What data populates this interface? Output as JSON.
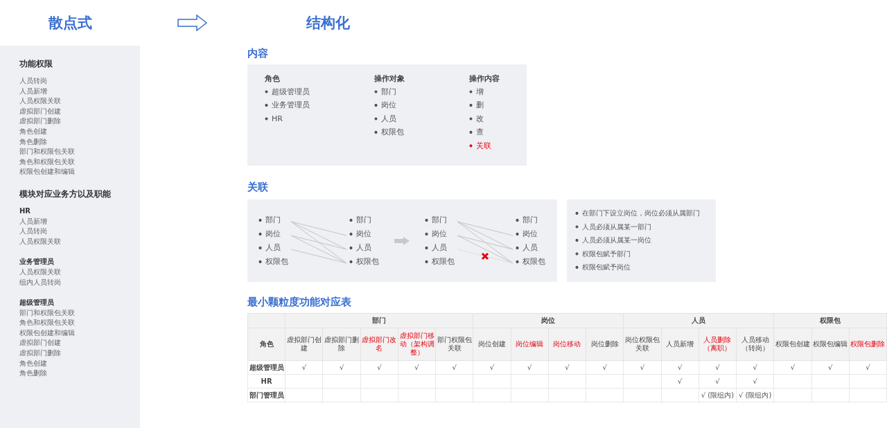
{
  "header": {
    "left_title": "散点式",
    "right_title": "结构化"
  },
  "sidebar": {
    "sections": [
      {
        "title": "功能权限",
        "groups": [
          {
            "items": [
              "人员转岗",
              "人员新增",
              "人员权限关联",
              "虚拟部门创建",
              "虚拟部门删除",
              "角色创建",
              "角色删除",
              "部门和权限包关联",
              "角色和权限包关联",
              "权限包创建和编辑"
            ]
          }
        ]
      },
      {
        "title": "模块对应业务方以及职能",
        "groups": [
          {
            "name": "HR",
            "items": [
              "人员新增",
              "人员转岗",
              "人员权限关联"
            ]
          },
          {
            "name": "业务管理员",
            "items": [
              "人员权限关联",
              "组内人员转岗"
            ]
          },
          {
            "name": "超级管理员",
            "items": [
              "部门和权限包关联",
              "角色和权限包关联",
              "权限包创建和编辑",
              "虚拟部门创建",
              "虚拟部门删除",
              "角色创建",
              "角色删除"
            ]
          }
        ]
      }
    ]
  },
  "content": {
    "title": "内容",
    "columns": [
      {
        "heading": "角色",
        "items": [
          {
            "text": "超级管理员",
            "highlight": false
          },
          {
            "text": "业务管理员",
            "highlight": false
          },
          {
            "text": "HR",
            "highlight": false
          }
        ]
      },
      {
        "heading": "操作对象",
        "items": [
          {
            "text": "部门",
            "highlight": false
          },
          {
            "text": "岗位",
            "highlight": false
          },
          {
            "text": "人员",
            "highlight": false
          },
          {
            "text": "权限包",
            "highlight": false
          }
        ]
      },
      {
        "heading": "操作内容",
        "items": [
          {
            "text": "增",
            "highlight": false
          },
          {
            "text": "删",
            "highlight": false
          },
          {
            "text": "改",
            "highlight": false
          },
          {
            "text": "查",
            "highlight": false
          },
          {
            "text": "关联",
            "highlight": true
          }
        ]
      }
    ]
  },
  "relations": {
    "title": "关联",
    "diagrams": [
      {
        "left": [
          "部门",
          "岗位",
          "人员",
          "权限包"
        ],
        "right": [
          "部门",
          "岗位",
          "人员",
          "权限包"
        ],
        "cut": false
      },
      {
        "left": [
          "部门",
          "岗位",
          "人员",
          "权限包"
        ],
        "right": [
          "部门",
          "岗位",
          "人员",
          "权限包"
        ],
        "cut": true
      }
    ],
    "rules": [
      "在部门下设立岗位，岗位必须从属部门",
      "人员必须从属某一部门",
      "人员必须从属某一岗位",
      "权限包赋予部门",
      "权限包赋予岗位"
    ]
  },
  "table": {
    "title": "最小颗粒度功能对应表",
    "role_heading": "角色",
    "groups": [
      {
        "name": "部门",
        "columns": [
          {
            "label": "虚拟部门创建",
            "highlight": false
          },
          {
            "label": "虚拟部门删除",
            "highlight": false
          },
          {
            "label": "虚拟部门改名",
            "highlight": true
          },
          {
            "label": "虚拟部门移动（架构调整）",
            "highlight": true
          },
          {
            "label": "部门权限包关联",
            "highlight": false
          }
        ]
      },
      {
        "name": "岗位",
        "columns": [
          {
            "label": "岗位创建",
            "highlight": false
          },
          {
            "label": "岗位编辑",
            "highlight": true
          },
          {
            "label": "岗位移动",
            "highlight": true
          },
          {
            "label": "岗位删除",
            "highlight": false
          }
        ]
      },
      {
        "name": "人员",
        "columns": [
          {
            "label": "岗位权限包关联",
            "highlight": false
          },
          {
            "label": "人员新增",
            "highlight": false
          },
          {
            "label": "人员删除（离职）",
            "highlight": true
          },
          {
            "label": "人员移动（转岗）",
            "highlight": false
          }
        ]
      },
      {
        "name": "权限包",
        "columns": [
          {
            "label": "权限包创建",
            "highlight": false
          },
          {
            "label": "权限包编辑",
            "highlight": false
          },
          {
            "label": "权限包删除",
            "highlight": true
          }
        ]
      }
    ],
    "rows": [
      {
        "role": "超级管理员",
        "cells": [
          "√",
          "√",
          "√",
          "√",
          "√",
          "√",
          "√",
          "√",
          "√",
          "√",
          "√",
          "√",
          "√",
          "√",
          "√",
          "√"
        ]
      },
      {
        "role": "HR",
        "cells": [
          "",
          "",
          "",
          "",
          "",
          "",
          "",
          "",
          "",
          "",
          "√",
          "√",
          "√",
          "",
          "",
          ""
        ]
      },
      {
        "role": "部门管理员",
        "cells": [
          "",
          "",
          "",
          "",
          "",
          "",
          "",
          "",
          "",
          "",
          "",
          "√ (限组内)",
          "√ (限组内)",
          "",
          "",
          ""
        ]
      }
    ]
  }
}
